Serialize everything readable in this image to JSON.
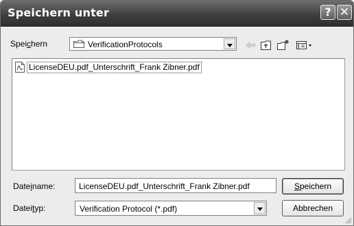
{
  "window": {
    "title": "Speichern unter"
  },
  "titlebar": {
    "help_label": "?",
    "close_label": "✕"
  },
  "location": {
    "label_pre": "Spei",
    "label_ul": "c",
    "label_post": "hern",
    "folder": "VerificationProtocols"
  },
  "toolbar_icons": [
    "back-icon",
    "up-folder-icon",
    "new-folder-icon",
    "view-menu-icon"
  ],
  "files": [
    {
      "name": "LicenseDEU.pdf_Unterschrift_Frank Zibner.pdf",
      "icon": "pdf-file-icon"
    }
  ],
  "filename": {
    "label_pre": "Date",
    "label_ul": "i",
    "label_post": "name:",
    "value": "LicenseDEU.pdf_Unterschrift_Frank Zibner.pdf"
  },
  "filetype": {
    "label_pre": "Datei",
    "label_ul": "t",
    "label_post": "yp:",
    "value": "Verification Protocol (*.pdf)"
  },
  "buttons": {
    "save_ul": "S",
    "save_rest": "peichern",
    "cancel": "Abbrechen"
  },
  "colors": {
    "titlebar": "#3f3f3f",
    "dialog_bg": "#ececec",
    "list_bg": "#ffffff"
  }
}
